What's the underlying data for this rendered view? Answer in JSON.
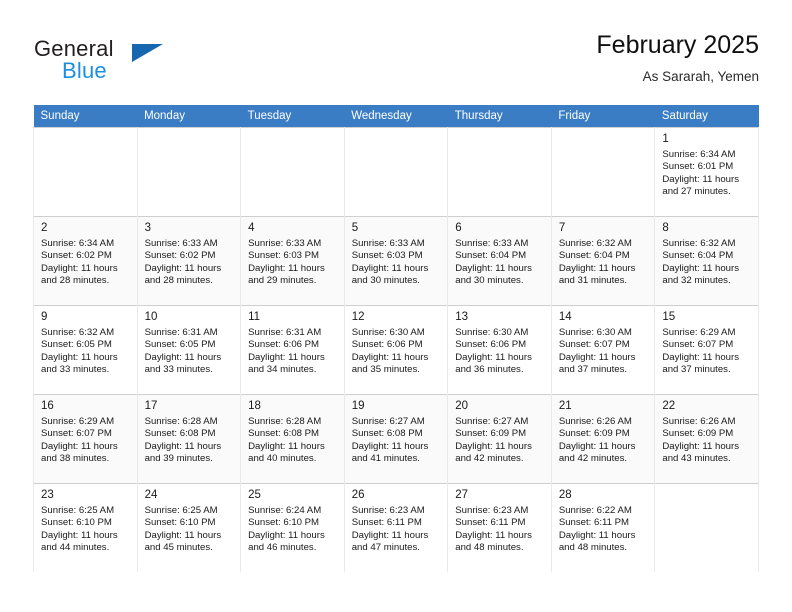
{
  "brand": {
    "name_part1": "General",
    "name_part2": "Blue",
    "logo_icon": "triangle-logo-icon",
    "color_dark": "#231f20",
    "color_blue": "#1d8fe0",
    "color_triangle": "#1667b0"
  },
  "header": {
    "month_title": "February 2025",
    "location": "As Sararah, Yemen"
  },
  "theme": {
    "header_row_bg": "#3b7dc4",
    "header_row_text": "#ffffff",
    "band_row_bg": "#fafafa",
    "cell_border": "#cfcfcf"
  },
  "weekdays": [
    "Sunday",
    "Monday",
    "Tuesday",
    "Wednesday",
    "Thursday",
    "Friday",
    "Saturday"
  ],
  "weeks": [
    [
      {
        "day": "",
        "sunrise": "",
        "sunset": "",
        "daylight_line1": "",
        "daylight_line2": ""
      },
      {
        "day": "",
        "sunrise": "",
        "sunset": "",
        "daylight_line1": "",
        "daylight_line2": ""
      },
      {
        "day": "",
        "sunrise": "",
        "sunset": "",
        "daylight_line1": "",
        "daylight_line2": ""
      },
      {
        "day": "",
        "sunrise": "",
        "sunset": "",
        "daylight_line1": "",
        "daylight_line2": ""
      },
      {
        "day": "",
        "sunrise": "",
        "sunset": "",
        "daylight_line1": "",
        "daylight_line2": ""
      },
      {
        "day": "",
        "sunrise": "",
        "sunset": "",
        "daylight_line1": "",
        "daylight_line2": ""
      },
      {
        "day": "1",
        "sunrise": "Sunrise: 6:34 AM",
        "sunset": "Sunset: 6:01 PM",
        "daylight_line1": "Daylight: 11 hours",
        "daylight_line2": "and 27 minutes."
      }
    ],
    [
      {
        "day": "2",
        "sunrise": "Sunrise: 6:34 AM",
        "sunset": "Sunset: 6:02 PM",
        "daylight_line1": "Daylight: 11 hours",
        "daylight_line2": "and 28 minutes."
      },
      {
        "day": "3",
        "sunrise": "Sunrise: 6:33 AM",
        "sunset": "Sunset: 6:02 PM",
        "daylight_line1": "Daylight: 11 hours",
        "daylight_line2": "and 28 minutes."
      },
      {
        "day": "4",
        "sunrise": "Sunrise: 6:33 AM",
        "sunset": "Sunset: 6:03 PM",
        "daylight_line1": "Daylight: 11 hours",
        "daylight_line2": "and 29 minutes."
      },
      {
        "day": "5",
        "sunrise": "Sunrise: 6:33 AM",
        "sunset": "Sunset: 6:03 PM",
        "daylight_line1": "Daylight: 11 hours",
        "daylight_line2": "and 30 minutes."
      },
      {
        "day": "6",
        "sunrise": "Sunrise: 6:33 AM",
        "sunset": "Sunset: 6:04 PM",
        "daylight_line1": "Daylight: 11 hours",
        "daylight_line2": "and 30 minutes."
      },
      {
        "day": "7",
        "sunrise": "Sunrise: 6:32 AM",
        "sunset": "Sunset: 6:04 PM",
        "daylight_line1": "Daylight: 11 hours",
        "daylight_line2": "and 31 minutes."
      },
      {
        "day": "8",
        "sunrise": "Sunrise: 6:32 AM",
        "sunset": "Sunset: 6:04 PM",
        "daylight_line1": "Daylight: 11 hours",
        "daylight_line2": "and 32 minutes."
      }
    ],
    [
      {
        "day": "9",
        "sunrise": "Sunrise: 6:32 AM",
        "sunset": "Sunset: 6:05 PM",
        "daylight_line1": "Daylight: 11 hours",
        "daylight_line2": "and 33 minutes."
      },
      {
        "day": "10",
        "sunrise": "Sunrise: 6:31 AM",
        "sunset": "Sunset: 6:05 PM",
        "daylight_line1": "Daylight: 11 hours",
        "daylight_line2": "and 33 minutes."
      },
      {
        "day": "11",
        "sunrise": "Sunrise: 6:31 AM",
        "sunset": "Sunset: 6:06 PM",
        "daylight_line1": "Daylight: 11 hours",
        "daylight_line2": "and 34 minutes."
      },
      {
        "day": "12",
        "sunrise": "Sunrise: 6:30 AM",
        "sunset": "Sunset: 6:06 PM",
        "daylight_line1": "Daylight: 11 hours",
        "daylight_line2": "and 35 minutes."
      },
      {
        "day": "13",
        "sunrise": "Sunrise: 6:30 AM",
        "sunset": "Sunset: 6:06 PM",
        "daylight_line1": "Daylight: 11 hours",
        "daylight_line2": "and 36 minutes."
      },
      {
        "day": "14",
        "sunrise": "Sunrise: 6:30 AM",
        "sunset": "Sunset: 6:07 PM",
        "daylight_line1": "Daylight: 11 hours",
        "daylight_line2": "and 37 minutes."
      },
      {
        "day": "15",
        "sunrise": "Sunrise: 6:29 AM",
        "sunset": "Sunset: 6:07 PM",
        "daylight_line1": "Daylight: 11 hours",
        "daylight_line2": "and 37 minutes."
      }
    ],
    [
      {
        "day": "16",
        "sunrise": "Sunrise: 6:29 AM",
        "sunset": "Sunset: 6:07 PM",
        "daylight_line1": "Daylight: 11 hours",
        "daylight_line2": "and 38 minutes."
      },
      {
        "day": "17",
        "sunrise": "Sunrise: 6:28 AM",
        "sunset": "Sunset: 6:08 PM",
        "daylight_line1": "Daylight: 11 hours",
        "daylight_line2": "and 39 minutes."
      },
      {
        "day": "18",
        "sunrise": "Sunrise: 6:28 AM",
        "sunset": "Sunset: 6:08 PM",
        "daylight_line1": "Daylight: 11 hours",
        "daylight_line2": "and 40 minutes."
      },
      {
        "day": "19",
        "sunrise": "Sunrise: 6:27 AM",
        "sunset": "Sunset: 6:08 PM",
        "daylight_line1": "Daylight: 11 hours",
        "daylight_line2": "and 41 minutes."
      },
      {
        "day": "20",
        "sunrise": "Sunrise: 6:27 AM",
        "sunset": "Sunset: 6:09 PM",
        "daylight_line1": "Daylight: 11 hours",
        "daylight_line2": "and 42 minutes."
      },
      {
        "day": "21",
        "sunrise": "Sunrise: 6:26 AM",
        "sunset": "Sunset: 6:09 PM",
        "daylight_line1": "Daylight: 11 hours",
        "daylight_line2": "and 42 minutes."
      },
      {
        "day": "22",
        "sunrise": "Sunrise: 6:26 AM",
        "sunset": "Sunset: 6:09 PM",
        "daylight_line1": "Daylight: 11 hours",
        "daylight_line2": "and 43 minutes."
      }
    ],
    [
      {
        "day": "23",
        "sunrise": "Sunrise: 6:25 AM",
        "sunset": "Sunset: 6:10 PM",
        "daylight_line1": "Daylight: 11 hours",
        "daylight_line2": "and 44 minutes."
      },
      {
        "day": "24",
        "sunrise": "Sunrise: 6:25 AM",
        "sunset": "Sunset: 6:10 PM",
        "daylight_line1": "Daylight: 11 hours",
        "daylight_line2": "and 45 minutes."
      },
      {
        "day": "25",
        "sunrise": "Sunrise: 6:24 AM",
        "sunset": "Sunset: 6:10 PM",
        "daylight_line1": "Daylight: 11 hours",
        "daylight_line2": "and 46 minutes."
      },
      {
        "day": "26",
        "sunrise": "Sunrise: 6:23 AM",
        "sunset": "Sunset: 6:11 PM",
        "daylight_line1": "Daylight: 11 hours",
        "daylight_line2": "and 47 minutes."
      },
      {
        "day": "27",
        "sunrise": "Sunrise: 6:23 AM",
        "sunset": "Sunset: 6:11 PM",
        "daylight_line1": "Daylight: 11 hours",
        "daylight_line2": "and 48 minutes."
      },
      {
        "day": "28",
        "sunrise": "Sunrise: 6:22 AM",
        "sunset": "Sunset: 6:11 PM",
        "daylight_line1": "Daylight: 11 hours",
        "daylight_line2": "and 48 minutes."
      },
      {
        "day": "",
        "sunrise": "",
        "sunset": "",
        "daylight_line1": "",
        "daylight_line2": ""
      }
    ]
  ]
}
